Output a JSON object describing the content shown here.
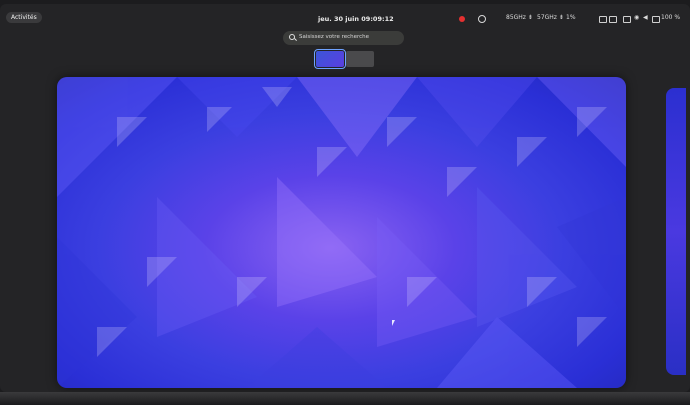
{
  "topbar": {
    "activities_label": "Activités",
    "clock": "jeu. 30 juin  09:09:12",
    "tray": {
      "item1": "85GHz  ⇟",
      "item2": "57GHz  ⇟",
      "item3": "1%",
      "battery": "100 %"
    }
  },
  "search": {
    "placeholder": "Saisissez votre recherche"
  },
  "workspaces": {
    "active_index": 0,
    "count": 2
  },
  "colors": {
    "accent": "#6fa3ff",
    "wallpaper_primary": "#3b3fe0",
    "wallpaper_highlight": "#8a63f2",
    "record_indicator": "#e53030"
  }
}
